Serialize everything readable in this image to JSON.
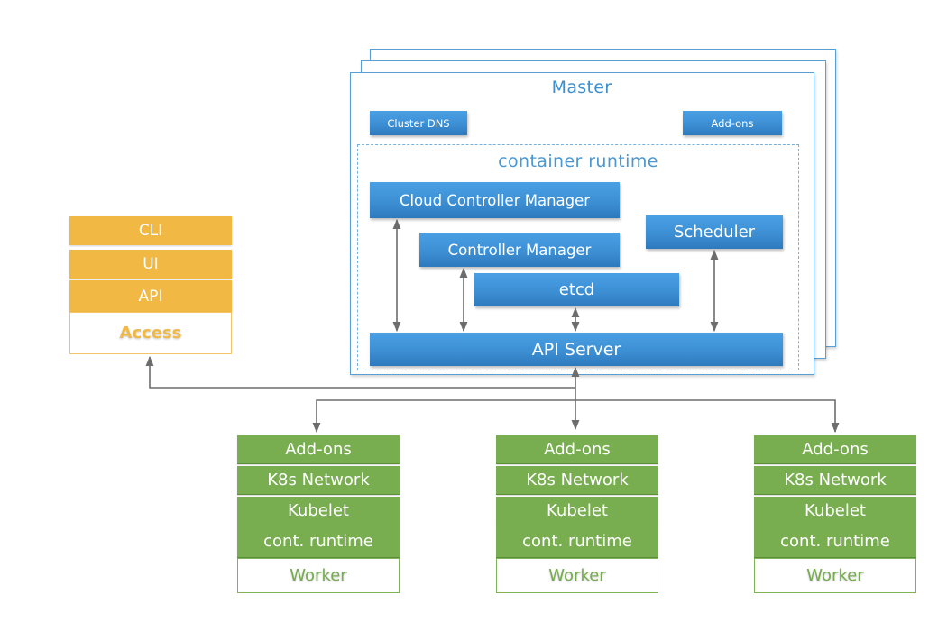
{
  "master": {
    "title": "Master",
    "top_components": {
      "cluster_dns": "Cluster DNS",
      "addons": "Add-ons"
    },
    "container_runtime": {
      "title": "container runtime",
      "components": {
        "cloud_controller_manager": "Cloud Controller Manager",
        "controller_manager": "Controller Manager",
        "scheduler": "Scheduler",
        "etcd": "etcd",
        "api_server": "API Server"
      }
    }
  },
  "access": {
    "layers": [
      "CLI",
      "UI",
      "API"
    ],
    "label": "Access"
  },
  "workers": [
    {
      "layers": [
        "Add-ons",
        "K8s Network",
        "Kubelet",
        "cont. runtime"
      ],
      "label": "Worker"
    },
    {
      "layers": [
        "Add-ons",
        "K8s Network",
        "Kubelet",
        "cont. runtime"
      ],
      "label": "Worker"
    },
    {
      "layers": [
        "Add-ons",
        "K8s Network",
        "Kubelet",
        "cont. runtime"
      ],
      "label": "Worker"
    }
  ],
  "colors": {
    "master_blue": "#3d8fd4",
    "access_yellow": "#f1b843",
    "worker_green": "#78ae50",
    "connector_gray": "#6d6d6d"
  }
}
